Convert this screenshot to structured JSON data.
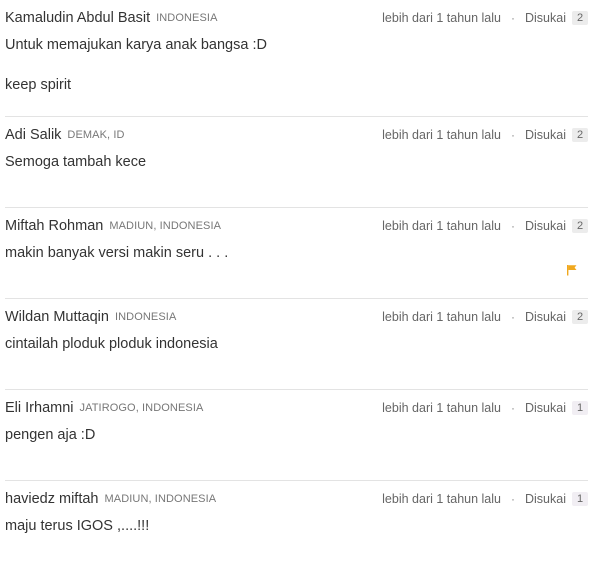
{
  "comments": [
    {
      "author": "Kamaludin Abdul Basit",
      "location": "INDONESIA",
      "time": "lebih dari 1 tahun lalu",
      "separator": "·",
      "like_label": "Disukai",
      "like_count": "2",
      "body": [
        "Untuk memajukan karya anak bangsa :D",
        "keep spirit"
      ]
    },
    {
      "author": "Adi Salik",
      "location": "DEMAK, ID",
      "time": "lebih dari 1 tahun lalu",
      "separator": "·",
      "like_label": "Disukai",
      "like_count": "2",
      "body": [
        "Semoga tambah kece"
      ]
    },
    {
      "author": "Miftah Rohman",
      "location": "MADIUN, INDONESIA",
      "time": "lebih dari 1 tahun lalu",
      "separator": "·",
      "like_label": "Disukai",
      "like_count": "2",
      "body": [
        "makin banyak versi makin seru . . ."
      ],
      "flag_icon": "flag-icon",
      "flag_color": "#f0a81e"
    },
    {
      "author": "Wildan Muttaqin",
      "location": "INDONESIA",
      "time": "lebih dari 1 tahun lalu",
      "separator": "·",
      "like_label": "Disukai",
      "like_count": "2",
      "body": [
        "cintailah ploduk ploduk indonesia"
      ]
    },
    {
      "author": "Eli Irhamni",
      "location": "JATIROGO, INDONESIA",
      "time": "lebih dari 1 tahun lalu",
      "separator": "·",
      "like_label": "Disukai",
      "like_count": "1",
      "body": [
        "pengen aja :D"
      ]
    },
    {
      "author": "haviedz miftah",
      "location": "MADIUN, INDONESIA",
      "time": "lebih dari 1 tahun lalu",
      "separator": "·",
      "like_label": "Disukai",
      "like_count": "1",
      "body": [
        "maju terus IGOS ,....!!!"
      ]
    }
  ],
  "colors": {
    "text": "#333333",
    "muted": "#777777",
    "divider": "#e3e3e3",
    "badge_bg": "#ececec",
    "flag": "#f0a81e"
  }
}
